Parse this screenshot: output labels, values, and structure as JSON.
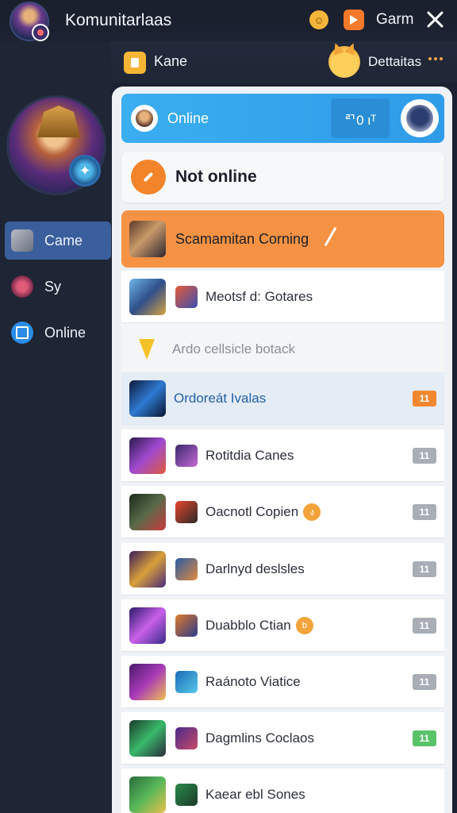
{
  "header": {
    "title": "Komunitarlaas",
    "game_label": "Garm",
    "icons": [
      "avatar",
      "emoji-icon",
      "orange-tag-icon",
      "close-icon"
    ]
  },
  "subheader": {
    "left_label": "Kane",
    "right_label": "Dettaitas"
  },
  "sidebar": {
    "items": [
      {
        "label": "Came",
        "icon": "game-icon",
        "active": true
      },
      {
        "label": "Sy",
        "icon": "sword-icon",
        "active": false
      },
      {
        "label": "Online",
        "icon": "online-icon",
        "active": false
      }
    ]
  },
  "panel": {
    "online": {
      "label": "Online",
      "code": "ꥤ0 ιᵀ"
    },
    "not_online": {
      "label": "Not online"
    },
    "coming": {
      "label": "Scamamitan Corning"
    },
    "rows": [
      {
        "label": "Meotsf d: Gotares",
        "badge": ""
      },
      {
        "label": "Ardo cellsicle botack",
        "badge": "",
        "hint": true
      },
      {
        "label": "Ordoreát Ivalas",
        "badge": "11",
        "badge_color": "#f3872f",
        "selected": true
      },
      {
        "label": "Rotitdia Canes",
        "badge": "11",
        "badge_color": "#a8adb6"
      },
      {
        "label": "Oacnotl Copien",
        "badge": "11",
        "badge_color": "#a8adb6",
        "coin": "ง"
      },
      {
        "label": "Darlnyd deslsles",
        "badge": "11",
        "badge_color": "#a8adb6"
      },
      {
        "label": "Duabblo Ctian",
        "badge": "11",
        "badge_color": "#a8adb6",
        "coin": "b"
      },
      {
        "label": "Raánoto Viatice",
        "badge": "11",
        "badge_color": "#a8adb6"
      },
      {
        "label": "Dagmlins Coclaos",
        "badge": "11",
        "badge_color": "#59c36a"
      },
      {
        "label": "Kaear ebl Sones",
        "badge": ""
      }
    ]
  }
}
